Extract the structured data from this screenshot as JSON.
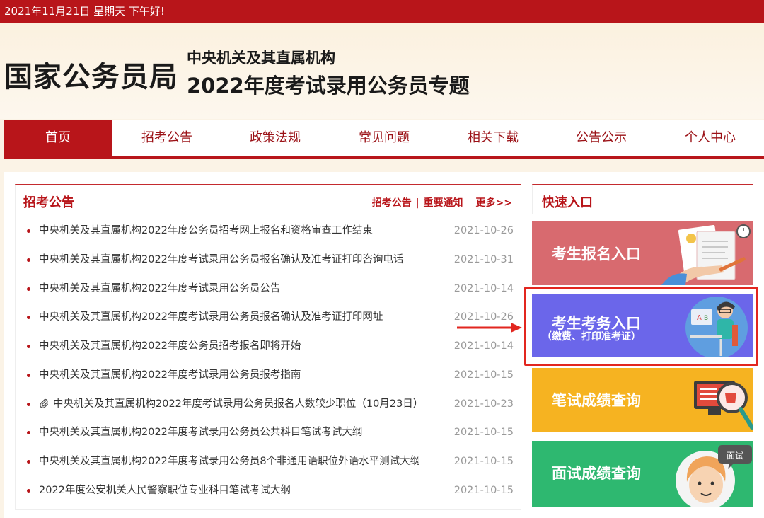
{
  "topbar": {
    "text": "2021年11月21日  星期天  下午好!"
  },
  "banner": {
    "agency": "国家公务员局",
    "subtitle_line1": "中央机关及其直属机构",
    "subtitle_line2": "2022年度考试录用公务员专题"
  },
  "nav": {
    "items": [
      {
        "label": "首页",
        "active": true
      },
      {
        "label": "招考公告"
      },
      {
        "label": "政策法规"
      },
      {
        "label": "常见问题"
      },
      {
        "label": "相关下载"
      },
      {
        "label": "公告公示"
      },
      {
        "label": "个人中心"
      }
    ]
  },
  "notice": {
    "title": "招考公告",
    "link1": "招考公告",
    "separator": "|",
    "link2": "重要通知",
    "more": "更多>>",
    "items": [
      {
        "title": "中央机关及其直属机构2022年度公务员招考网上报名和资格审查工作结束",
        "date": "2021-10-26"
      },
      {
        "title": "中央机关及其直属机构2022年度考试录用公务员报名确认及准考证打印咨询电话",
        "date": "2021-10-31"
      },
      {
        "title": "中央机关及其直属机构2022年度考试录用公务员公告",
        "date": "2021-10-14"
      },
      {
        "title": "中央机关及其直属机构2022年度考试录用公务员报名确认及准考证打印网址",
        "date": "2021-10-26"
      },
      {
        "title": "中央机关及其直属机构2022年度公务员招考报名即将开始",
        "date": "2021-10-14"
      },
      {
        "title": "中央机关及其直属机构2022年度考试录用公务员报考指南",
        "date": "2021-10-15"
      },
      {
        "title": "中央机关及其直属机构2022年度考试录用公务员报名人数较少职位（10月23日）",
        "date": "2021-10-23",
        "attachment": true
      },
      {
        "title": "中央机关及其直属机构2022年度考试录用公务员公共科目笔试考试大纲",
        "date": "2021-10-15"
      },
      {
        "title": "中央机关及其直属机构2022年度考试录用公务员8个非通用语职位外语水平测试大纲",
        "date": "2021-10-15"
      },
      {
        "title": "2022年度公安机关人民警察职位专业科目笔试考试大纲",
        "date": "2021-10-15"
      }
    ]
  },
  "quick": {
    "title": "快速入口",
    "cards": [
      {
        "label": "考生报名入口",
        "color": "#d86a6f",
        "icon": "document-sign-icon"
      },
      {
        "label": "考生考务入口",
        "sublabel": "（缴费、打印准考证）",
        "color": "#6b66ea",
        "icon": "student-desk-icon"
      },
      {
        "label": "笔试成绩查询",
        "color": "#f6b321",
        "icon": "magnifier-screen-icon"
      },
      {
        "label": "面试成绩查询",
        "color": "#2eb870",
        "icon": "interview-face-icon",
        "bubble": "面试"
      }
    ]
  },
  "colors": {
    "brand_red": "#b8151a",
    "highlight_red": "#e2261f"
  }
}
